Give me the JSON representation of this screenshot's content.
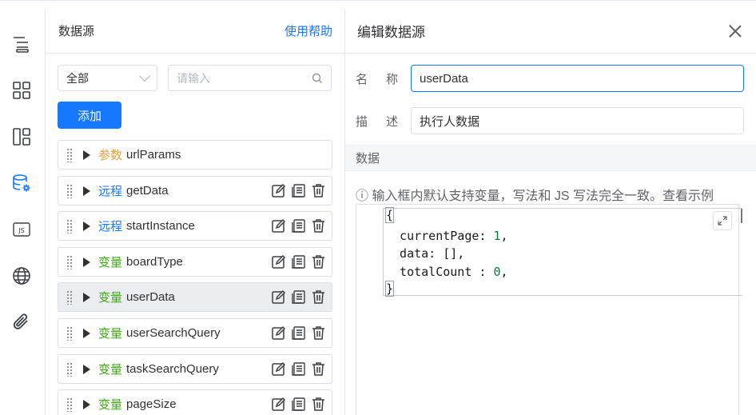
{
  "datasource_panel": {
    "title": "数据源",
    "help": "使用帮助",
    "filter_select": "全部",
    "search_placeholder": "请输入",
    "add_button": "添加",
    "items": [
      {
        "type_label": "参数",
        "type": "param",
        "name": "urlParams",
        "show_ops": false
      },
      {
        "type_label": "远程",
        "type": "remote",
        "name": "getData",
        "show_ops": true
      },
      {
        "type_label": "远程",
        "type": "remote",
        "name": "startInstance",
        "show_ops": true
      },
      {
        "type_label": "变量",
        "type": "var",
        "name": "boardType",
        "show_ops": true
      },
      {
        "type_label": "变量",
        "type": "var",
        "name": "userData",
        "show_ops": true,
        "active": true
      },
      {
        "type_label": "变量",
        "type": "var",
        "name": "userSearchQuery",
        "show_ops": true
      },
      {
        "type_label": "变量",
        "type": "var",
        "name": "taskSearchQuery",
        "show_ops": true
      },
      {
        "type_label": "变量",
        "type": "var",
        "name": "pageSize",
        "show_ops": true
      }
    ]
  },
  "edit_panel": {
    "title": "编辑数据源",
    "name_label": "名称",
    "name_value": "userData",
    "desc_label": "描述",
    "desc_value": "执行人数据",
    "section_title": "数据",
    "hint": "ⓘ 输入框内默认支持变量，写法和 JS 写法完全一致。查看示例",
    "code": {
      "open": "{",
      "line1_key": "  currentPage: ",
      "line1_val": "1",
      "line1_end": ",",
      "line2": "  data: [],",
      "line3_key": "  totalCount : ",
      "line3_val": "0",
      "line3_end": ",",
      "close": "}"
    }
  },
  "rail_icons": [
    "outline-icon",
    "components-icon",
    "layout-icon",
    "datasource-settings-icon",
    "js-icon",
    "globe-icon",
    "attachment-icon"
  ],
  "colors": {
    "accent": "#1677ff",
    "param": "#e6a23c",
    "var": "#41a817"
  }
}
